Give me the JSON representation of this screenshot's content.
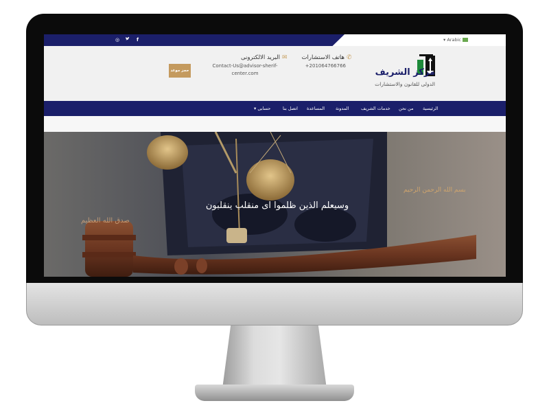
{
  "topbar": {
    "social": {
      "instagram": "◎",
      "twitter": "🐦",
      "facebook": "f"
    },
    "language": "Arabic"
  },
  "header": {
    "brand_title": "مركز الشريف",
    "brand_subtitle": "الدولى للقانون والاستشارات",
    "phone_label": "هاتف الاستشارات",
    "phone_value": "+201064766766",
    "email_label": "البريد الالكترونى",
    "email_value": "Contact-Us@advisor-sherif-center.com",
    "book_button": "حجز موعد"
  },
  "nav": {
    "items": [
      "الرئيسية",
      "من نحن",
      "خدمات الشريف",
      "المدونة",
      "المساعدة",
      "اتصل بنا",
      "حسابى"
    ]
  },
  "hero": {
    "main_text": "وسيعلم الذين ظلموا اى منقلب ينقلبون",
    "right_text": "بسم الله الرحمن الرحيم",
    "left_text": "صدق الله العظيم"
  },
  "colors": {
    "primary": "#1b1f6a",
    "accent": "#c49a5e",
    "background": "#f1f1f1"
  }
}
